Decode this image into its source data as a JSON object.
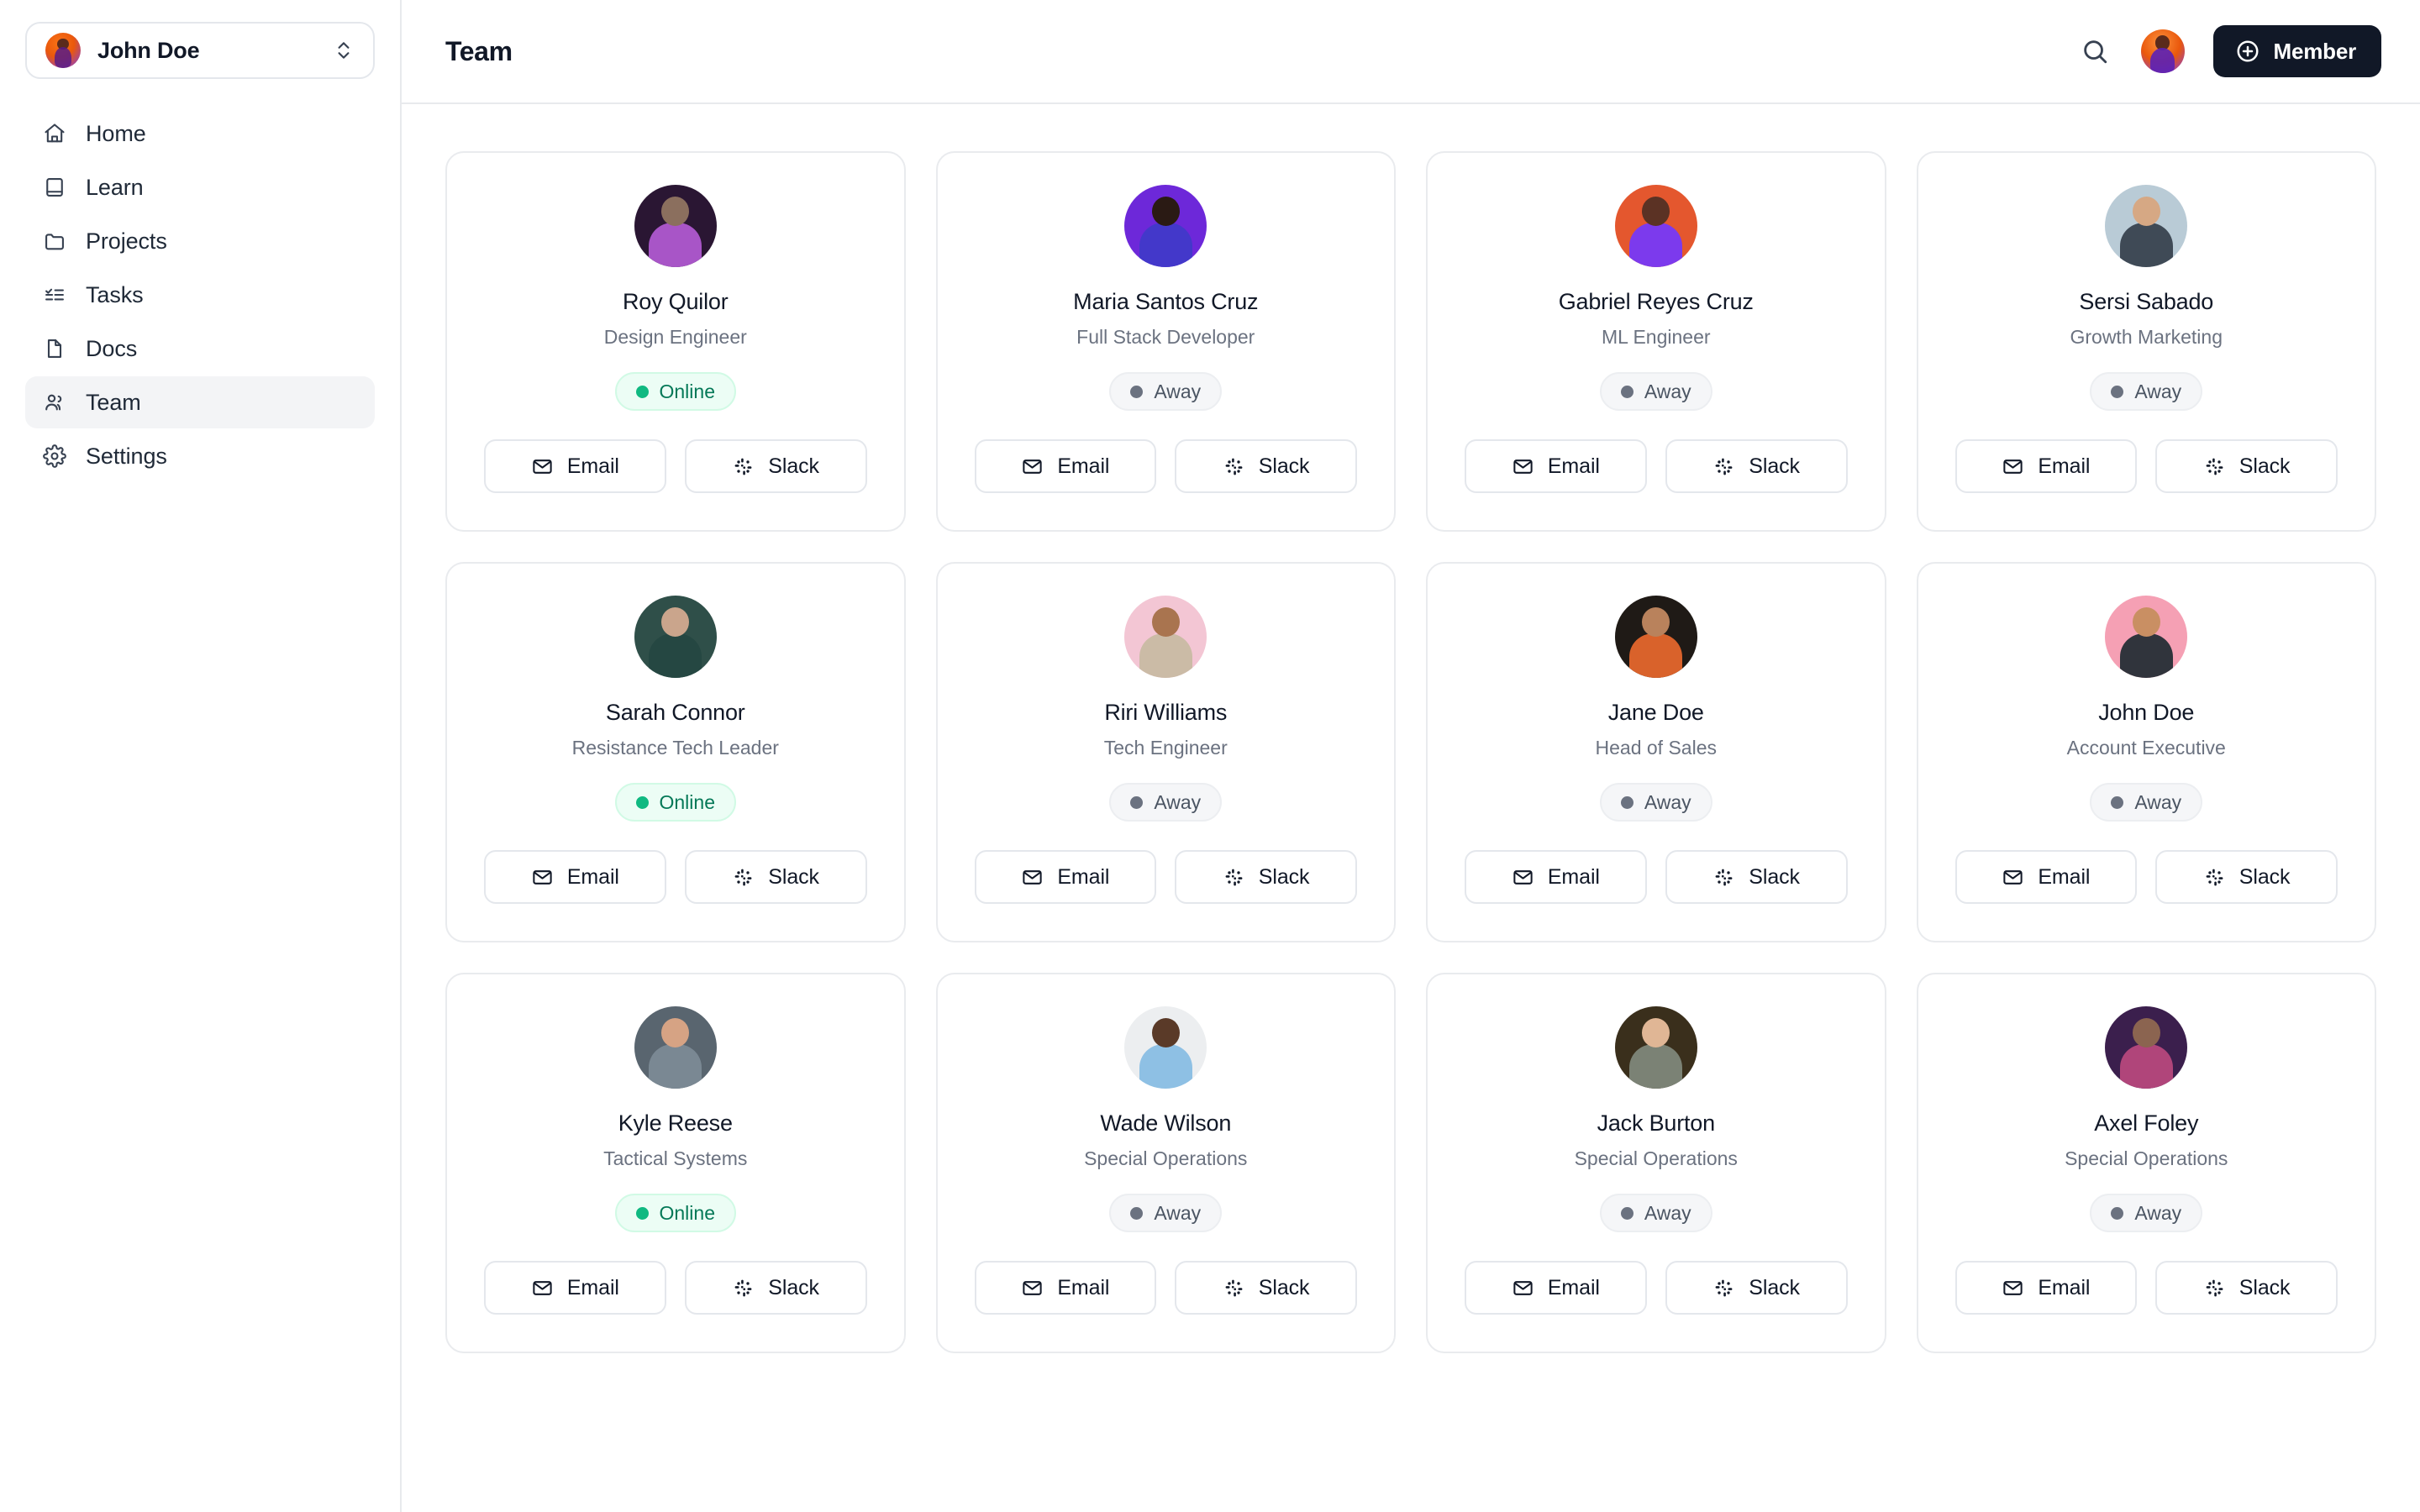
{
  "sidebar": {
    "workspace": {
      "name": "John Doe",
      "avatar_colors": [
        "#f97316",
        "#7c3aed"
      ],
      "switcher_icon": "chevron-up-down-icon"
    },
    "items": [
      {
        "label": "Home",
        "icon": "home-icon",
        "active": false
      },
      {
        "label": "Learn",
        "icon": "book-icon",
        "active": false
      },
      {
        "label": "Projects",
        "icon": "folder-icon",
        "active": false
      },
      {
        "label": "Tasks",
        "icon": "checklist-icon",
        "active": false
      },
      {
        "label": "Docs",
        "icon": "document-icon",
        "active": false
      },
      {
        "label": "Team",
        "icon": "users-icon",
        "active": true
      },
      {
        "label": "Settings",
        "icon": "gear-icon",
        "active": false
      }
    ]
  },
  "header": {
    "title": "Team",
    "search_icon": "search-icon",
    "avatar_icon": "user-avatar",
    "add_member_label": "Member",
    "add_member_icon": "plus-circle-icon",
    "add_member_bg": "#111827"
  },
  "labels": {
    "email": "Email",
    "slack": "Slack",
    "email_icon": "envelope-icon",
    "slack_icon": "slack-icon"
  },
  "status_colors": {
    "online_bg": "#ecfdf5",
    "online_dot": "#10b981",
    "online_text": "#047857",
    "away_bg": "#f5f6f8",
    "away_dot": "#6b7280",
    "away_text": "#4b5563"
  },
  "team": [
    {
      "name": "Roy Quilor",
      "role": "Design Engineer",
      "status": "Online",
      "status_type": "online",
      "avatar_bg": "#2a1633",
      "avatar_head": "#8b6f5e",
      "avatar_body": "#a855c7"
    },
    {
      "name": "Maria Santos Cruz",
      "role": "Full Stack Developer",
      "status": "Away",
      "status_type": "away",
      "avatar_bg": "#6d28d9",
      "avatar_head": "#2a1a14",
      "avatar_body": "#4338ca"
    },
    {
      "name": "Gabriel Reyes Cruz",
      "role": "ML Engineer",
      "status": "Away",
      "status_type": "away",
      "avatar_bg": "#e4572e",
      "avatar_head": "#5b3224",
      "avatar_body": "#7c3aed"
    },
    {
      "name": "Sersi Sabado",
      "role": "Growth Marketing",
      "status": "Away",
      "status_type": "away",
      "avatar_bg": "#b9cbd6",
      "avatar_head": "#d6a884",
      "avatar_body": "#3f4a56"
    },
    {
      "name": "Sarah Connor",
      "role": "Resistance Tech Leader",
      "status": "Online",
      "status_type": "online",
      "avatar_bg": "#2f4f49",
      "avatar_head": "#caa58c",
      "avatar_body": "#254742"
    },
    {
      "name": "Riri Williams",
      "role": "Tech Engineer",
      "status": "Away",
      "status_type": "away",
      "avatar_bg": "#f3c6d4",
      "avatar_head": "#a9744f",
      "avatar_body": "#cbbba6"
    },
    {
      "name": "Jane Doe",
      "role": "Head of Sales",
      "status": "Away",
      "status_type": "away",
      "avatar_bg": "#1f1a16",
      "avatar_head": "#b9825c",
      "avatar_body": "#d9622b"
    },
    {
      "name": "John Doe",
      "role": "Account Executive",
      "status": "Away",
      "status_type": "away",
      "avatar_bg": "#f5a0b4",
      "avatar_head": "#c98f63",
      "avatar_body": "#30343c"
    },
    {
      "name": "Kyle Reese",
      "role": "Tactical Systems",
      "status": "Online",
      "status_type": "online",
      "avatar_bg": "#59656f",
      "avatar_head": "#d6a384",
      "avatar_body": "#7a8893"
    },
    {
      "name": "Wade Wilson",
      "role": "Special Operations",
      "status": "Away",
      "status_type": "away",
      "avatar_bg": "#eceef0",
      "avatar_head": "#5a3a28",
      "avatar_body": "#8ec0e4"
    },
    {
      "name": "Jack Burton",
      "role": "Special Operations",
      "status": "Away",
      "status_type": "away",
      "avatar_bg": "#3a2f1c",
      "avatar_head": "#e0b695",
      "avatar_body": "#7b8275"
    },
    {
      "name": "Axel Foley",
      "role": "Special Operations",
      "status": "Away",
      "status_type": "away",
      "avatar_bg": "#3b1f4d",
      "avatar_head": "#8b6450",
      "avatar_body": "#b0457a"
    }
  ]
}
